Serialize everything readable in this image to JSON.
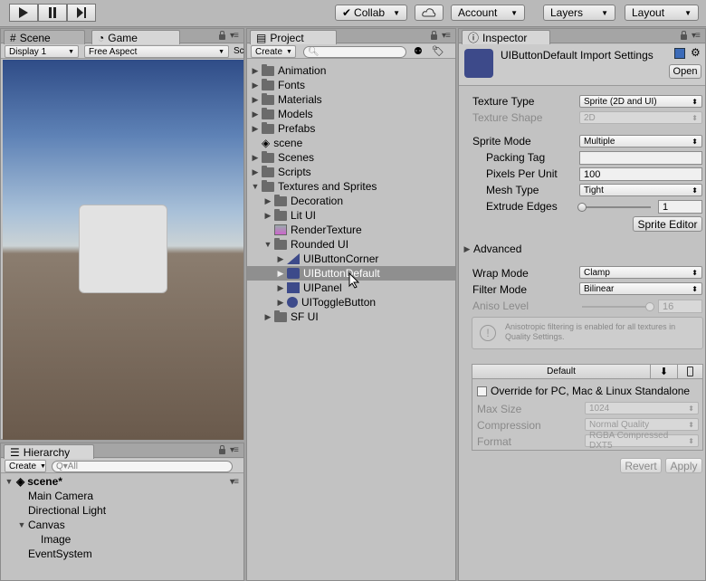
{
  "toolbar": {
    "collab": "Collab",
    "account": "Account",
    "layers": "Layers",
    "layout": "Layout"
  },
  "left_tabs": {
    "scene": "Scene",
    "game": "Game"
  },
  "game": {
    "display": "Display 1",
    "aspect": "Free Aspect",
    "scale": "Sc"
  },
  "hierarchy": {
    "tab": "Hierarchy",
    "create": "Create",
    "search_placeholder": "Q▾All",
    "scene": "scene*",
    "items": [
      "Main Camera",
      "Directional Light",
      "Canvas",
      "Image",
      "EventSystem"
    ]
  },
  "project": {
    "tab": "Project",
    "create": "Create",
    "items": [
      "Animation",
      "Fonts",
      "Materials",
      "Models",
      "Prefabs",
      "scene",
      "Scenes",
      "Scripts",
      "Textures and Sprites",
      "Decoration",
      "Lit UI",
      "RenderTexture",
      "Rounded UI",
      "UIButtonCorner",
      "UIButtonDefault",
      "UIPanel",
      "UIToggleButton",
      "SF UI"
    ]
  },
  "inspector": {
    "tab": "Inspector",
    "title": "UIButtonDefault Import Settings",
    "open": "Open",
    "texture_type_label": "Texture Type",
    "texture_type": "Sprite (2D and UI)",
    "texture_shape_label": "Texture Shape",
    "texture_shape": "2D",
    "sprite_mode_label": "Sprite Mode",
    "sprite_mode": "Multiple",
    "packing_tag_label": "Packing Tag",
    "packing_tag": "",
    "ppu_label": "Pixels Per Unit",
    "ppu": "100",
    "mesh_type_label": "Mesh Type",
    "mesh_type": "Tight",
    "extrude_label": "Extrude Edges",
    "extrude": "1",
    "extrude_fraction": 0.0,
    "sprite_editor": "Sprite Editor",
    "advanced": "Advanced",
    "wrap_label": "Wrap Mode",
    "wrap": "Clamp",
    "filter_label": "Filter Mode",
    "filter": "Bilinear",
    "aniso_label": "Aniso Level",
    "aniso": "16",
    "aniso_note": "Anisotropic filtering is enabled for all textures in Quality Settings.",
    "platform_default": "Default",
    "override": "Override for PC, Mac & Linux Standalone",
    "maxsize_label": "Max Size",
    "maxsize": "1024",
    "compression_label": "Compression",
    "compression": "Normal Quality",
    "format_label": "Format",
    "format": "RGBA Compressed DXT5",
    "revert": "Revert",
    "apply": "Apply"
  },
  "colors": {
    "accent_selection": "#8f8f8f",
    "sprite_blue": "#3d4a8a"
  }
}
